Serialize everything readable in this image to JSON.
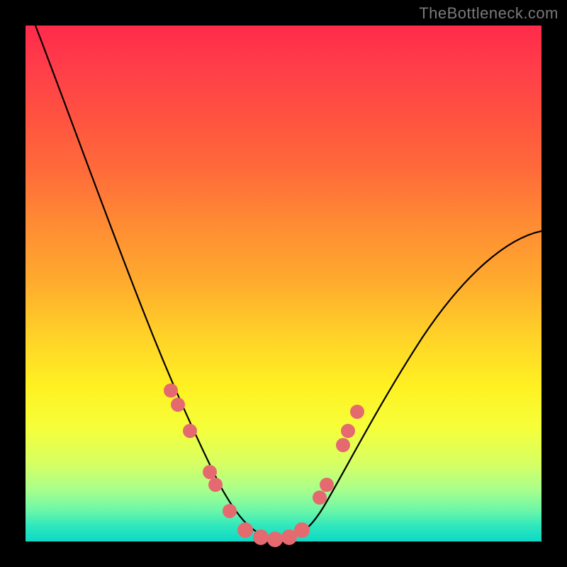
{
  "watermark": "TheBottleneck.com",
  "colors": {
    "dot": "#e56a6f",
    "curve": "#000000",
    "frame": "#000000"
  },
  "chart_data": {
    "type": "line",
    "title": "",
    "xlabel": "",
    "ylabel": "",
    "xlim": [
      0,
      100
    ],
    "ylim": [
      0,
      100
    ],
    "legend": false,
    "grid": false,
    "series": [
      {
        "name": "bottleneck-curve",
        "x": [
          2,
          6,
          12,
          18,
          24,
          30,
          34,
          38,
          42,
          46,
          50,
          54,
          58,
          65,
          75,
          85,
          95,
          100
        ],
        "y": [
          100,
          90,
          76,
          62,
          48,
          36,
          26,
          16,
          8,
          3,
          1,
          3,
          8,
          18,
          32,
          44,
          53,
          57
        ]
      }
    ],
    "markers": {
      "name": "highlight-points",
      "x": [
        27,
        28,
        31,
        35,
        36,
        39,
        42,
        45,
        48,
        51,
        53,
        56,
        57,
        60,
        61,
        62
      ],
      "y": [
        28,
        26,
        20,
        12,
        10,
        5,
        2,
        1,
        1,
        2,
        4,
        10,
        12,
        20,
        23,
        26
      ]
    }
  }
}
